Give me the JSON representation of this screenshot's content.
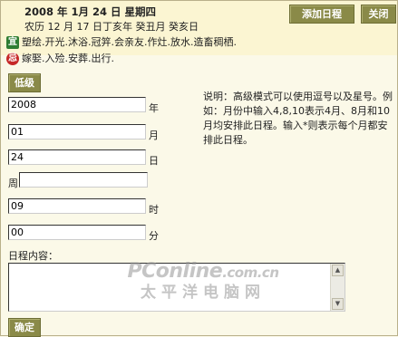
{
  "header": {
    "date_title": "2008 年  1月  24 日  星期四",
    "lunar": "农历  12  月  17 日丁亥年  癸丑月  癸亥日",
    "yi_badge": "宜",
    "yi_text": "塑绘.开光.沐浴.冠笄.会亲友.作灶.放水.造畜稠栖.",
    "ji_badge": "忌",
    "ji_text": "嫁娶.入殓.安葬.出行."
  },
  "buttons": {
    "add_schedule": "添加日程",
    "close": "关闭",
    "level": "低级",
    "confirm": "确定"
  },
  "form": {
    "year_value": "2008",
    "year_label": "年",
    "month_value": "01",
    "month_label": "月",
    "day_value": "24",
    "day_label": "日",
    "week_label": "周",
    "week_value": "",
    "hour_value": "09",
    "hour_label": "时",
    "minute_value": "00",
    "minute_label": "分",
    "content_label": "日程内容：",
    "content_value": ""
  },
  "note": "说明：高级模式可以使用逗号以及星号。例如：月份中输入4,8,10表示4月、8月和10月均安排此日程。输入*则表示每个月都安排此日程。",
  "watermark": {
    "brand": "PConline",
    "domain": ".com.cn",
    "chinese": "太平洋电脑网"
  },
  "colors": {
    "background": "#fbf9e8",
    "button": "#8a8a48",
    "yi_badge": "#2e7d32",
    "ji_badge": "#c62828"
  }
}
